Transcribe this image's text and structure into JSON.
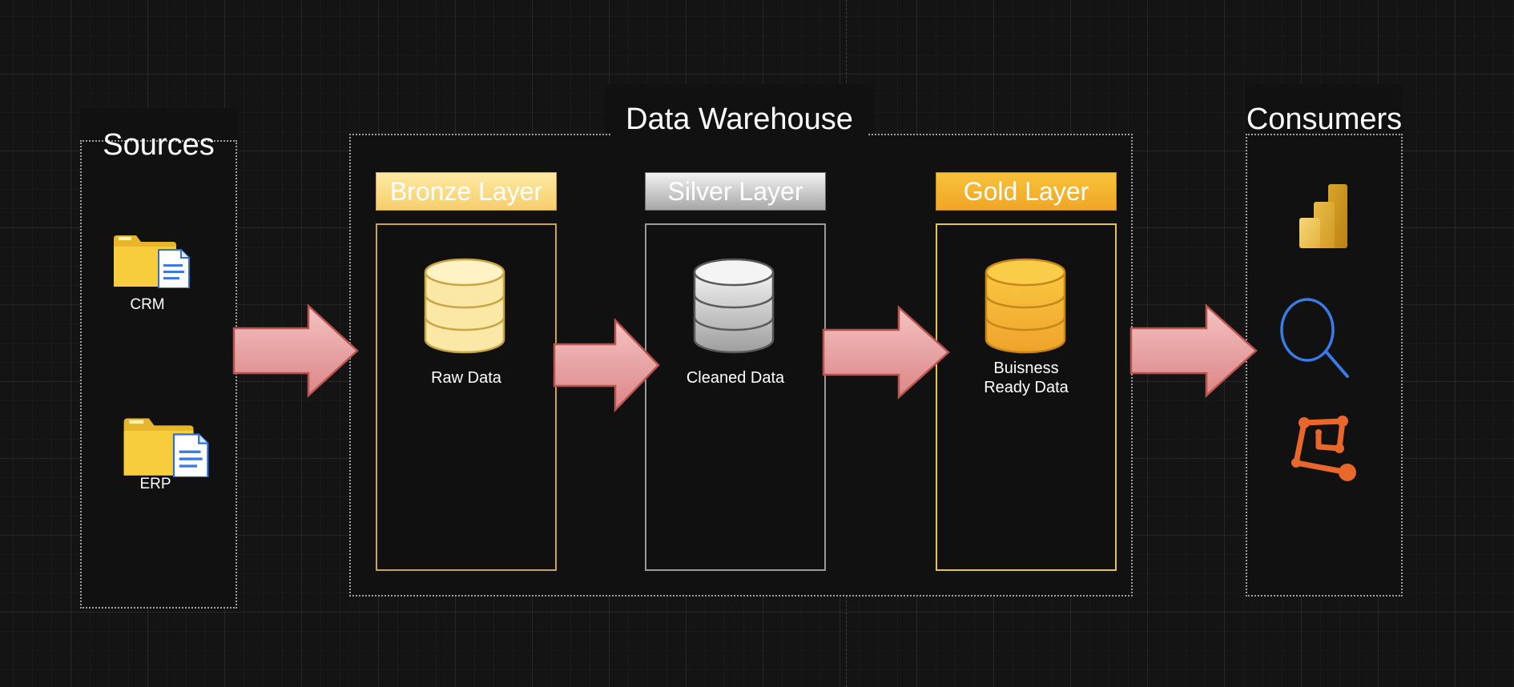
{
  "sources": {
    "title": "Sources",
    "items": [
      {
        "label": "CRM",
        "icon": "folder-document-icon"
      },
      {
        "label": "ERP",
        "icon": "folder-document-icon"
      }
    ]
  },
  "warehouse": {
    "title": "Data Warehouse",
    "layers": [
      {
        "name": "Bronze Layer",
        "label": "Raw Data",
        "color": "#f5cf6a",
        "icon": "database-icon"
      },
      {
        "name": "Silver Layer",
        "label": "Cleaned Data",
        "color": "#b5b5b5",
        "icon": "database-icon"
      },
      {
        "name": "Gold Layer",
        "label": "Buisness\nReady Data",
        "color": "#f0a626",
        "icon": "database-icon"
      }
    ]
  },
  "consumers": {
    "title": "Consumers",
    "icons": [
      "bar-chart-icon",
      "search-icon",
      "network-graph-icon"
    ]
  },
  "colors": {
    "arrow_fill": "#e79595",
    "arrow_stroke": "#b85450",
    "background": "#141414"
  }
}
